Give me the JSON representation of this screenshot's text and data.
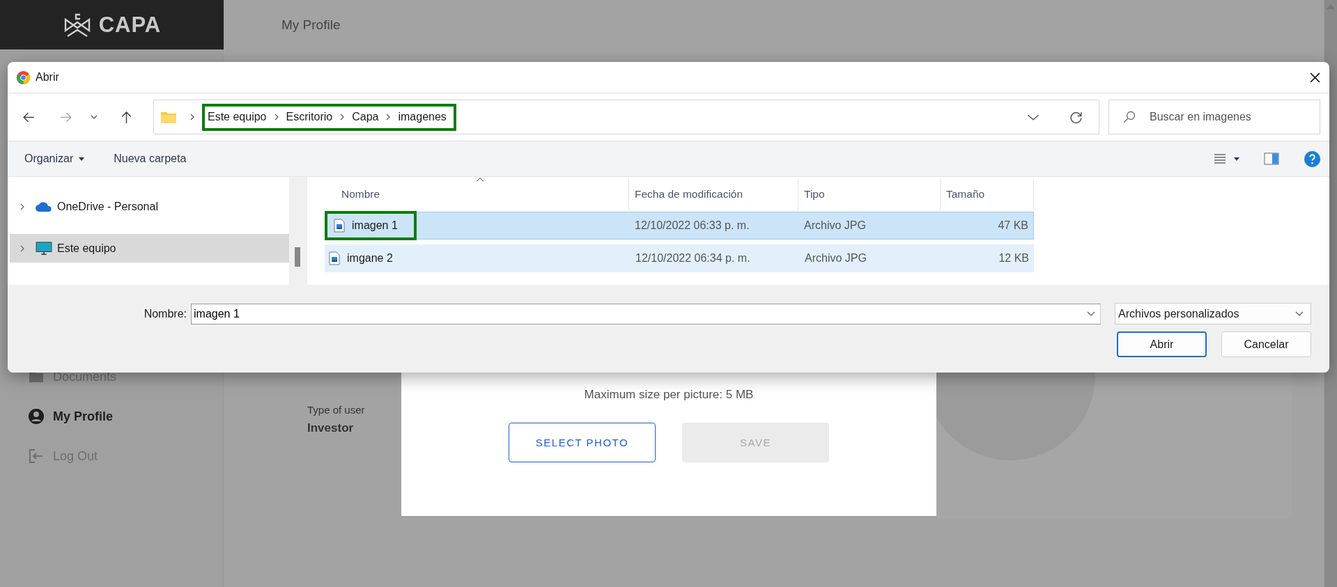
{
  "app": {
    "logo": "CAPA",
    "page_title": "My Profile",
    "sidebar": [
      {
        "label": "Documents",
        "kind": "folder",
        "selected": false
      },
      {
        "label": "My Profile",
        "kind": "profile",
        "selected": true
      },
      {
        "label": "Log Out",
        "kind": "logout",
        "selected": false
      }
    ],
    "profile": {
      "field_label": "Type of user",
      "field_value": "Investor"
    },
    "photo_modal": {
      "hint": "Maximum size per picture: 5 MB",
      "buttons": [
        {
          "label": "SELECT PHOTO",
          "disabled": false
        },
        {
          "label": "SAVE",
          "disabled": true
        }
      ]
    }
  },
  "dialog": {
    "title": "Abrir",
    "breadcrumb": {
      "highlighted": true,
      "items": [
        "Este equipo",
        "Escritorio",
        "Capa",
        "imagenes"
      ]
    },
    "search": {
      "placeholder": "Buscar en imagenes"
    },
    "toolbar": [
      {
        "label": "Organizar",
        "kind": "menu"
      },
      {
        "label": "Nueva carpeta",
        "kind": "button"
      }
    ],
    "nav_pane": [
      {
        "label": "OneDrive - Personal",
        "kind": "cloud",
        "selected": false
      },
      {
        "label": "Este equipo",
        "kind": "computer",
        "selected": true
      }
    ],
    "columns": [
      "Nombre",
      "Fecha de modificación",
      "Tipo",
      "Tamaño"
    ],
    "files": [
      {
        "name": "imagen 1",
        "modified": "12/10/2022 06:33 p. m.",
        "type": "Archivo JPG",
        "size": "47 KB",
        "selected": true,
        "hovered": false,
        "highlighted": true
      },
      {
        "name": "imgane 2",
        "modified": "12/10/2022 06:34 p. m.",
        "type": "Archivo JPG",
        "size": "12 KB",
        "selected": false,
        "hovered": true,
        "highlighted": false
      }
    ],
    "filename_label": "Nombre:",
    "filename": "imagen 1",
    "filter": "Archivos personalizados",
    "buttons": [
      {
        "label": "Abrir",
        "kind": "primary"
      },
      {
        "label": "Cancelar",
        "kind": "secondary"
      }
    ]
  }
}
